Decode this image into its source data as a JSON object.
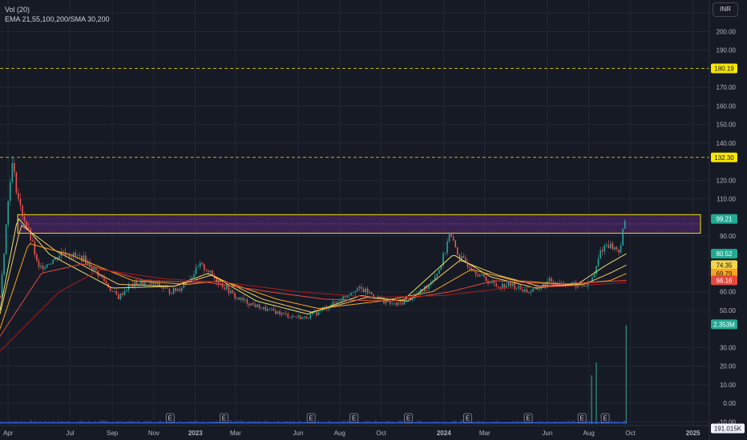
{
  "legend": {
    "volume": "Vol (20)",
    "moving_averages": "EMA 21,55,100,200/SMA 30,200"
  },
  "currency": "INR",
  "chart_data": {
    "type": "candlestick",
    "title": "",
    "ylim": [
      -12,
      217
    ],
    "y_ticks": [
      "210.00",
      "200.00",
      "190.00",
      "170.00",
      "160.00",
      "150.00",
      "140.00",
      "120.00",
      "110.00",
      "90.00",
      "60.00",
      "50.00",
      "30.00",
      "20.00",
      "10.00",
      "0.00",
      "-10.00"
    ],
    "x_ticks": [
      "Apr",
      "Jul",
      "Sep",
      "Nov",
      "2023",
      "Mar",
      "Jun",
      "Aug",
      "Oct",
      "2024",
      "Mar",
      "Jun",
      "Aug",
      "Oct",
      "2025"
    ],
    "x_range": [
      "2022-03-20",
      "2025-01-25"
    ],
    "price_path": [
      [
        "2022-03-20",
        58
      ],
      [
        "2022-03-25",
        78
      ],
      [
        "2022-03-30",
        100
      ],
      [
        "2022-04-03",
        118
      ],
      [
        "2022-04-06",
        130
      ],
      [
        "2022-04-12",
        118
      ],
      [
        "2022-04-18",
        106
      ],
      [
        "2022-04-24",
        100
      ],
      [
        "2022-05-01",
        92
      ],
      [
        "2022-05-08",
        84
      ],
      [
        "2022-05-15",
        72
      ],
      [
        "2022-05-22",
        74
      ],
      [
        "2022-06-01",
        76
      ],
      [
        "2022-06-10",
        78
      ],
      [
        "2022-06-20",
        82
      ],
      [
        "2022-07-01",
        80
      ],
      [
        "2022-07-20",
        78
      ],
      [
        "2022-08-05",
        72
      ],
      [
        "2022-08-20",
        66
      ],
      [
        "2022-09-01",
        60
      ],
      [
        "2022-09-10",
        57
      ],
      [
        "2022-09-25",
        63
      ],
      [
        "2022-10-15",
        65
      ],
      [
        "2022-11-05",
        64
      ],
      [
        "2022-11-25",
        60
      ],
      [
        "2022-12-10",
        62
      ],
      [
        "2022-12-25",
        68
      ],
      [
        "2023-01-08",
        74
      ],
      [
        "2023-01-18",
        72
      ],
      [
        "2023-02-01",
        66
      ],
      [
        "2023-02-15",
        62
      ],
      [
        "2023-03-01",
        57
      ],
      [
        "2023-03-20",
        54
      ],
      [
        "2023-04-10",
        51
      ],
      [
        "2023-05-01",
        49
      ],
      [
        "2023-05-20",
        47
      ],
      [
        "2023-06-10",
        46
      ],
      [
        "2023-06-25",
        48
      ],
      [
        "2023-07-10",
        51
      ],
      [
        "2023-07-25",
        54
      ],
      [
        "2023-08-10",
        58
      ],
      [
        "2023-08-25",
        62
      ],
      [
        "2023-09-10",
        60
      ],
      [
        "2023-09-25",
        57
      ],
      [
        "2023-10-10",
        54
      ],
      [
        "2023-10-25",
        53
      ],
      [
        "2023-11-10",
        56
      ],
      [
        "2023-11-25",
        59
      ],
      [
        "2023-12-10",
        64
      ],
      [
        "2023-12-25",
        72
      ],
      [
        "2024-01-03",
        82
      ],
      [
        "2024-01-08",
        92
      ],
      [
        "2024-01-15",
        86
      ],
      [
        "2024-01-25",
        78
      ],
      [
        "2024-02-05",
        75
      ],
      [
        "2024-02-20",
        70
      ],
      [
        "2024-03-05",
        66
      ],
      [
        "2024-03-20",
        63
      ],
      [
        "2024-04-05",
        64
      ],
      [
        "2024-04-20",
        62
      ],
      [
        "2024-05-05",
        60
      ],
      [
        "2024-05-20",
        62
      ],
      [
        "2024-06-05",
        66
      ],
      [
        "2024-06-20",
        65
      ],
      [
        "2024-07-05",
        64
      ],
      [
        "2024-07-20",
        63
      ],
      [
        "2024-08-01",
        64
      ],
      [
        "2024-08-10",
        70
      ],
      [
        "2024-08-18",
        82
      ],
      [
        "2024-08-28",
        86
      ],
      [
        "2024-09-05",
        84
      ],
      [
        "2024-09-15",
        82
      ],
      [
        "2024-09-22",
        96
      ],
      [
        "2024-09-25",
        99.21
      ]
    ],
    "volume_spikes": [
      [
        "2024-08-05",
        15
      ],
      [
        "2024-08-12",
        22
      ],
      [
        "2024-09-25",
        42
      ]
    ],
    "earnings_markers": [
      "2022-11-25",
      "2023-02-12",
      "2023-06-20",
      "2023-08-22",
      "2023-11-10",
      "2024-02-05",
      "2024-05-04",
      "2024-07-22",
      "2024-08-25"
    ],
    "series": [
      {
        "role": "ema21",
        "color": "#e6e06a",
        "values": [
          [
            "2022-03-20",
            50
          ],
          [
            "2022-04-15",
            100
          ],
          [
            "2022-06-01",
            80
          ],
          [
            "2022-09-01",
            62
          ],
          [
            "2022-12-01",
            63
          ],
          [
            "2023-01-20",
            70
          ],
          [
            "2023-04-01",
            55
          ],
          [
            "2023-06-15",
            48
          ],
          [
            "2023-09-01",
            58
          ],
          [
            "2023-11-01",
            55
          ],
          [
            "2024-01-15",
            80
          ],
          [
            "2024-03-10",
            68
          ],
          [
            "2024-05-15",
            62
          ],
          [
            "2024-07-15",
            64
          ],
          [
            "2024-08-25",
            74
          ],
          [
            "2024-09-25",
            80.52
          ]
        ]
      },
      {
        "role": "sma30",
        "color": "#f3c860",
        "values": [
          [
            "2022-03-20",
            48
          ],
          [
            "2022-04-20",
            96
          ],
          [
            "2022-06-10",
            82
          ],
          [
            "2022-09-10",
            64
          ],
          [
            "2022-12-01",
            63
          ],
          [
            "2023-01-25",
            69
          ],
          [
            "2023-04-10",
            56
          ],
          [
            "2023-06-20",
            49
          ],
          [
            "2023-09-10",
            57
          ],
          [
            "2023-11-10",
            55
          ],
          [
            "2024-01-25",
            77
          ],
          [
            "2024-03-20",
            69
          ],
          [
            "2024-05-20",
            63
          ],
          [
            "2024-07-25",
            64
          ],
          [
            "2024-09-01",
            70
          ],
          [
            "2024-09-25",
            74.35
          ]
        ]
      },
      {
        "role": "ema55",
        "color": "#f7a520",
        "values": [
          [
            "2022-03-20",
            40
          ],
          [
            "2022-05-01",
            86
          ],
          [
            "2022-07-01",
            80
          ],
          [
            "2022-10-01",
            66
          ],
          [
            "2022-12-20",
            64
          ],
          [
            "2023-02-10",
            66
          ],
          [
            "2023-05-01",
            56
          ],
          [
            "2023-07-01",
            51
          ],
          [
            "2023-10-01",
            55
          ],
          [
            "2023-12-15",
            60
          ],
          [
            "2024-02-10",
            72
          ],
          [
            "2024-04-15",
            66
          ],
          [
            "2024-07-01",
            64
          ],
          [
            "2024-09-01",
            66
          ],
          [
            "2024-09-25",
            69.79
          ]
        ]
      },
      {
        "role": "ema100",
        "color": "#e8483c",
        "values": [
          [
            "2022-03-20",
            36
          ],
          [
            "2022-05-20",
            70
          ],
          [
            "2022-07-20",
            75
          ],
          [
            "2022-10-20",
            66
          ],
          [
            "2023-01-20",
            65
          ],
          [
            "2023-04-20",
            60
          ],
          [
            "2023-07-10",
            56
          ],
          [
            "2023-10-15",
            55
          ],
          [
            "2024-01-10",
            60
          ],
          [
            "2024-03-15",
            66
          ],
          [
            "2024-06-15",
            64
          ],
          [
            "2024-09-25",
            66.16
          ]
        ]
      },
      {
        "role": "ema200",
        "color": "#a81c1c",
        "values": [
          [
            "2022-03-20",
            28
          ],
          [
            "2022-06-15",
            60
          ],
          [
            "2022-08-15",
            72
          ],
          [
            "2022-11-15",
            67
          ],
          [
            "2023-02-15",
            65
          ],
          [
            "2023-06-01",
            60
          ],
          [
            "2023-09-20",
            57
          ],
          [
            "2024-01-01",
            58
          ],
          [
            "2024-04-01",
            62
          ],
          [
            "2024-07-01",
            63
          ],
          [
            "2024-09-25",
            65
          ]
        ]
      }
    ],
    "h_lines": [
      {
        "value": 180.19,
        "label": "180.19",
        "color": "#f7e600",
        "style": "dashed"
      },
      {
        "value": 132.3,
        "label": "132.30",
        "color": "#f7e600",
        "style": "dashed"
      }
    ],
    "zone": {
      "y1": 91.5,
      "y2": 101.5,
      "x1": "2022-04-15",
      "x2": "2025-01-12",
      "fill": "#5a2a7a",
      "stroke": "#f2e300"
    },
    "price_labels": [
      {
        "value": 99.21,
        "label": "99.21",
        "bg": "#22ab94",
        "fg": "#ffffff"
      },
      {
        "value": 80.52,
        "label": "80.52",
        "bg": "#22ab94",
        "fg": "#ffffff"
      },
      {
        "value": 74.35,
        "label": "74.35",
        "bg": "#f3d34a",
        "fg": "#131722"
      },
      {
        "value": 69.79,
        "label": "69.79",
        "bg": "#f7a520",
        "fg": "#131722"
      },
      {
        "value": 66.16,
        "label": "66.16",
        "bg": "#e8483c",
        "fg": "#ffffff"
      },
      {
        "value": 42.5,
        "label": "2.353M",
        "bg": "#22ab94",
        "fg": "#ffffff"
      },
      {
        "value": -13.5,
        "label": "191.015K",
        "bg": "#f0f3fa",
        "fg": "#131722"
      }
    ],
    "earnings_label": "E",
    "colors": {
      "up": "#26a69a",
      "down": "#ef5350",
      "grid": "#232734",
      "axis_text": "#b2b5be"
    }
  }
}
